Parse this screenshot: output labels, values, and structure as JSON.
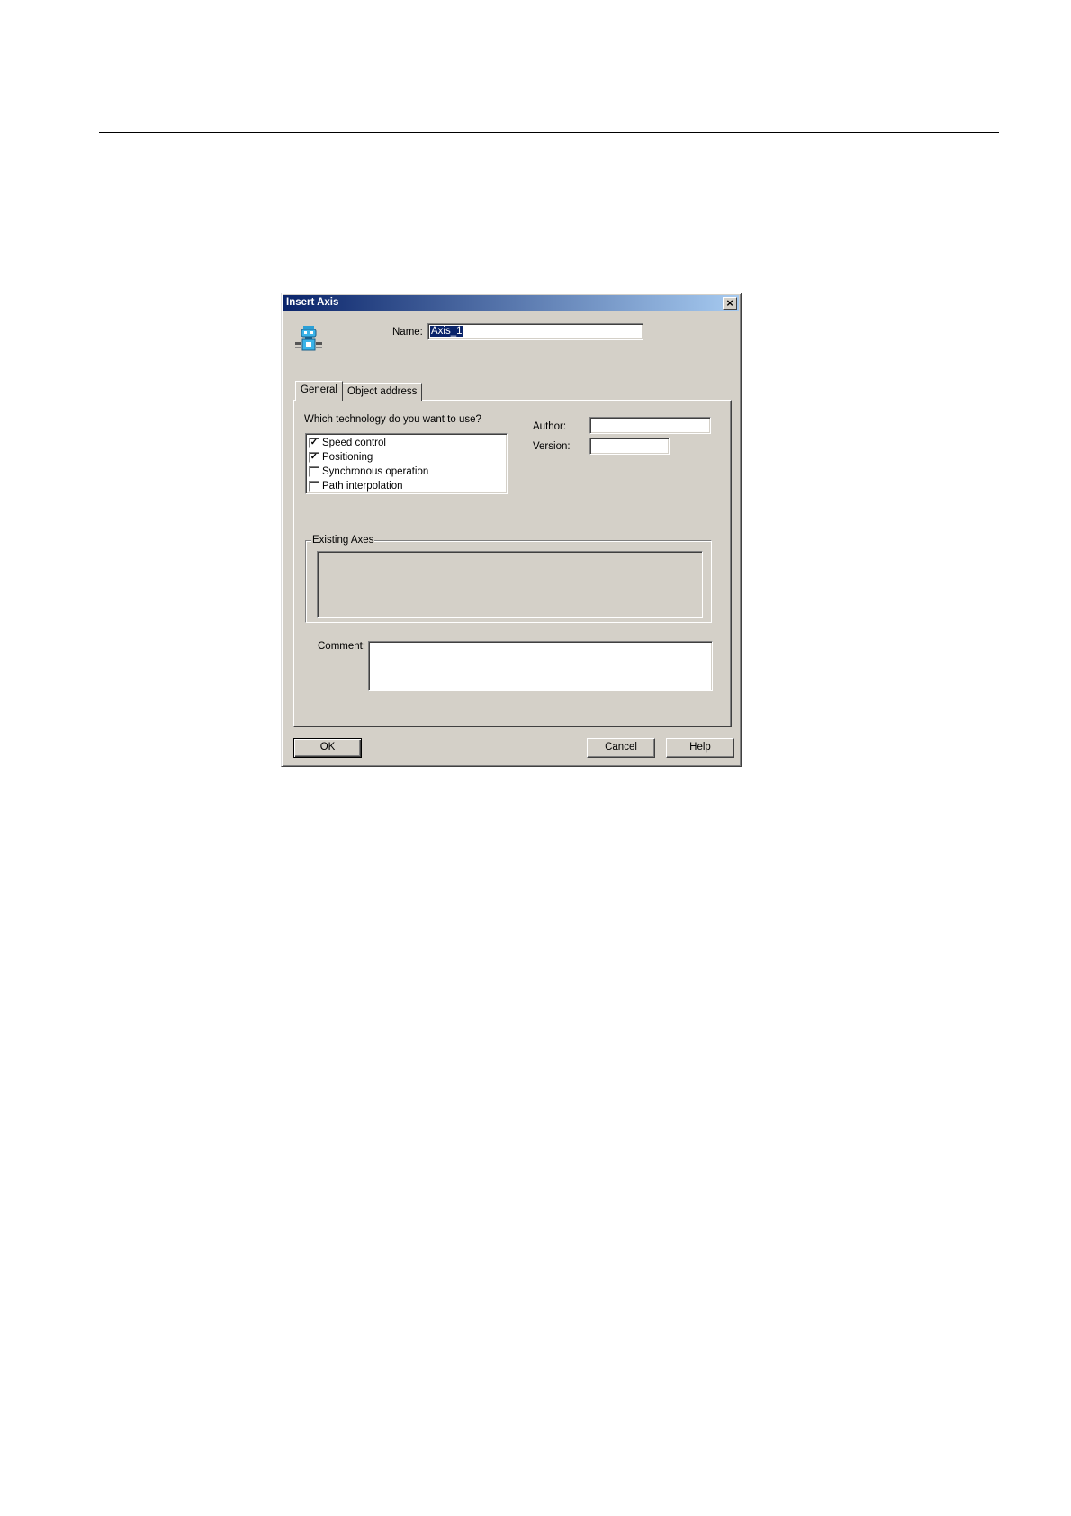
{
  "window": {
    "title": "Insert Axis",
    "close_glyph": "×"
  },
  "icon": "axis-robot-icon",
  "name": {
    "label": "Name:",
    "value": "Axis_1"
  },
  "tabs": [
    {
      "label": "General",
      "selected": true
    },
    {
      "label": "Object address",
      "selected": false
    }
  ],
  "technology": {
    "question": "Which technology do you want to use?",
    "items": [
      {
        "label": "Speed control",
        "checked": true
      },
      {
        "label": "Positioning",
        "checked": true
      },
      {
        "label": "Synchronous operation",
        "checked": false
      },
      {
        "label": "Path interpolation",
        "checked": false
      }
    ]
  },
  "author": {
    "label": "Author:",
    "value": ""
  },
  "version": {
    "label": "Version:",
    "value": ""
  },
  "existing_axes": {
    "caption": "Existing Axes"
  },
  "comment": {
    "label": "Comment:",
    "value": ""
  },
  "buttons": {
    "ok": "OK",
    "cancel": "Cancel",
    "help": "Help"
  },
  "colors": {
    "face": "#d4d0c8",
    "title_start": "#0a246a",
    "title_end": "#a6caf0",
    "selection": "#0a246a"
  }
}
